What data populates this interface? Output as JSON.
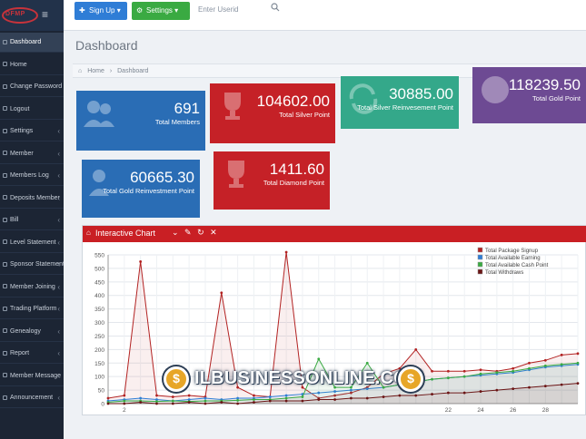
{
  "sidebar": {
    "logo": "DFMP",
    "items": [
      {
        "label": "Dashboard",
        "active": true,
        "chevron": ""
      },
      {
        "label": "Home",
        "chevron": ""
      },
      {
        "label": "Change Password",
        "chevron": ""
      },
      {
        "label": "Logout",
        "chevron": ""
      },
      {
        "label": "Settings",
        "chevron": "‹"
      },
      {
        "label": "Member",
        "chevron": "‹"
      },
      {
        "label": "Members Log",
        "chevron": "‹"
      },
      {
        "label": "Deposits Member",
        "chevron": "‹"
      },
      {
        "label": "Bill",
        "chevron": "‹"
      },
      {
        "label": "Level Statement",
        "chevron": "‹"
      },
      {
        "label": "Sponsor Statement",
        "chevron": "‹"
      },
      {
        "label": "Member Joining",
        "chevron": "‹"
      },
      {
        "label": "Trading Platform",
        "chevron": "‹"
      },
      {
        "label": "Genealogy",
        "chevron": "‹"
      },
      {
        "label": "Report",
        "chevron": "‹"
      },
      {
        "label": "Member Message",
        "chevron": "‹"
      },
      {
        "label": "Announcement",
        "chevron": "‹"
      }
    ]
  },
  "topbar": {
    "signup_label": "Sign Up",
    "settings_label": "Settings",
    "userid_placeholder": "Enter Userid"
  },
  "page": {
    "title": "Dashboard",
    "breadcrumb": [
      "Home",
      "›",
      "Dashboard"
    ]
  },
  "stats": [
    {
      "value": "691",
      "label": "Total Members",
      "color": "#2a6db5"
    },
    {
      "value": "104602.00",
      "label": "Total Silver Point",
      "color": "#c52127"
    },
    {
      "value": "30885.00",
      "label": "Total Silver Reinvesement Point",
      "color": "#34a88a"
    },
    {
      "value": "118239.50",
      "label": "Total Gold Point",
      "color": "#6d4a93"
    },
    {
      "value": "60665.30",
      "label": "Total Gold Reinvestment Point",
      "color": "#2a6db5"
    },
    {
      "value": "1411.60",
      "label": "Total Diamond Point",
      "color": "#c52127"
    }
  ],
  "chart_panel": {
    "title": "Interactive Chart",
    "tools": "⌄ ✎ ↻ ✕"
  },
  "chart_data": {
    "type": "line",
    "title": "Interactive Chart",
    "yticks": [
      0,
      50,
      100,
      150,
      200,
      250,
      300,
      350,
      400,
      450,
      500,
      550
    ],
    "ylim": [
      0,
      550
    ],
    "xticks": [
      2,
      22,
      24,
      26,
      28
    ],
    "xlim": [
      1,
      30
    ],
    "grid": true,
    "legend": "top-right",
    "series": [
      {
        "name": "Total Package Signup",
        "color": "#b22222",
        "x": [
          1,
          2,
          3,
          4,
          5,
          6,
          7,
          8,
          9,
          10,
          11,
          12,
          13,
          14,
          15,
          16,
          17,
          18,
          19,
          20,
          21,
          22,
          23,
          24,
          25,
          26,
          27,
          28,
          29,
          30
        ],
        "values": [
          20,
          30,
          525,
          30,
          25,
          30,
          25,
          410,
          60,
          30,
          25,
          560,
          60,
          20,
          30,
          40,
          60,
          110,
          130,
          200,
          120,
          120,
          120,
          125,
          120,
          130,
          150,
          160,
          180,
          185
        ]
      },
      {
        "name": "Total Available Earning",
        "color": "#2f7dd6",
        "x": [
          1,
          2,
          3,
          4,
          5,
          6,
          7,
          8,
          9,
          10,
          11,
          12,
          13,
          14,
          15,
          16,
          17,
          18,
          19,
          20,
          21,
          22,
          23,
          24,
          25,
          26,
          27,
          28,
          29,
          30
        ],
        "values": [
          10,
          15,
          20,
          15,
          10,
          15,
          20,
          15,
          20,
          20,
          25,
          30,
          35,
          40,
          45,
          50,
          55,
          60,
          70,
          80,
          90,
          95,
          100,
          105,
          110,
          115,
          125,
          135,
          140,
          145
        ]
      },
      {
        "name": "Total Available Cash Point",
        "color": "#3aaa42",
        "x": [
          1,
          2,
          3,
          4,
          5,
          6,
          7,
          8,
          9,
          10,
          11,
          12,
          13,
          14,
          15,
          16,
          17,
          18,
          19,
          20,
          21,
          22,
          23,
          24,
          25,
          26,
          27,
          28,
          29,
          30
        ],
        "values": [
          5,
          10,
          10,
          8,
          10,
          8,
          10,
          10,
          12,
          15,
          15,
          20,
          25,
          165,
          60,
          60,
          150,
          60,
          70,
          80,
          90,
          95,
          100,
          110,
          115,
          120,
          130,
          140,
          145,
          150
        ]
      },
      {
        "name": "Total Withdraws",
        "color": "#6b1515",
        "x": [
          1,
          2,
          3,
          4,
          5,
          6,
          7,
          8,
          9,
          10,
          11,
          12,
          13,
          14,
          15,
          16,
          17,
          18,
          19,
          20,
          21,
          22,
          23,
          24,
          25,
          26,
          27,
          28,
          29,
          30
        ],
        "values": [
          0,
          0,
          5,
          0,
          0,
          5,
          0,
          5,
          0,
          5,
          10,
          10,
          10,
          15,
          15,
          20,
          20,
          25,
          30,
          30,
          35,
          40,
          40,
          45,
          50,
          55,
          60,
          65,
          70,
          75
        ]
      }
    ]
  },
  "watermark": {
    "text": "ILBUSINESSONLINE.COM",
    "coin_symbol": "$"
  }
}
